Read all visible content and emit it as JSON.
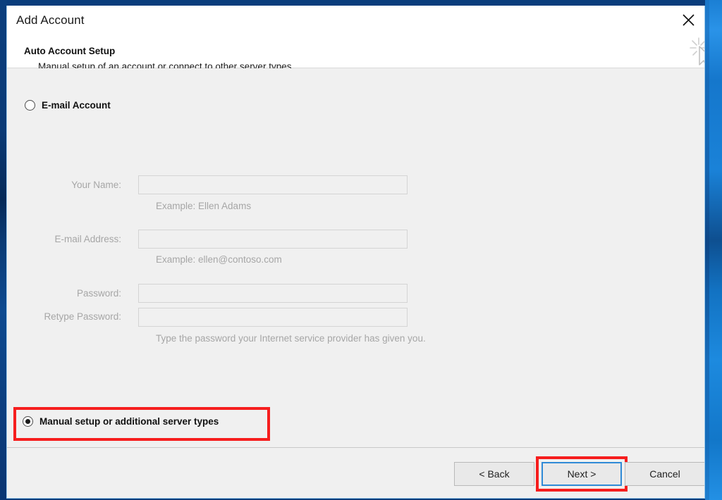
{
  "window": {
    "title": "Add Account",
    "close_icon": "close-icon"
  },
  "header": {
    "heading": "Auto Account Setup",
    "subheading": "Manual setup of an account or connect to other server types."
  },
  "cursor": {
    "icon": "mouse-pointer-click-icon"
  },
  "options": {
    "email_account": {
      "label": "E-mail Account",
      "selected": false
    },
    "manual_setup": {
      "label": "Manual setup or additional server types",
      "selected": true
    }
  },
  "form": {
    "fields": [
      {
        "label": "Your Name:",
        "value": "",
        "hint": "Example: Ellen Adams"
      },
      {
        "label": "E-mail Address:",
        "value": "",
        "hint": "Example: ellen@contoso.com"
      },
      {
        "label": "Password:",
        "value": "",
        "hint": ""
      },
      {
        "label": "Retype Password:",
        "value": "",
        "hint": "Type the password your Internet service provider has given you."
      }
    ],
    "disabled": true
  },
  "footer": {
    "back_label": "< Back",
    "next_label": "Next >",
    "cancel_label": "Cancel"
  },
  "annotations": {
    "color": "#f61e1e",
    "targets": [
      "manual-setup-radio",
      "next-button"
    ]
  },
  "colors": {
    "desktop_blue": "#0a3d7c",
    "accent_blue": "#2f8ad6",
    "dialog_bg": "#f0f0f0",
    "header_bg": "#ffffff",
    "disabled_text": "#a6a6a6",
    "annotation_red": "#f61e1e"
  }
}
